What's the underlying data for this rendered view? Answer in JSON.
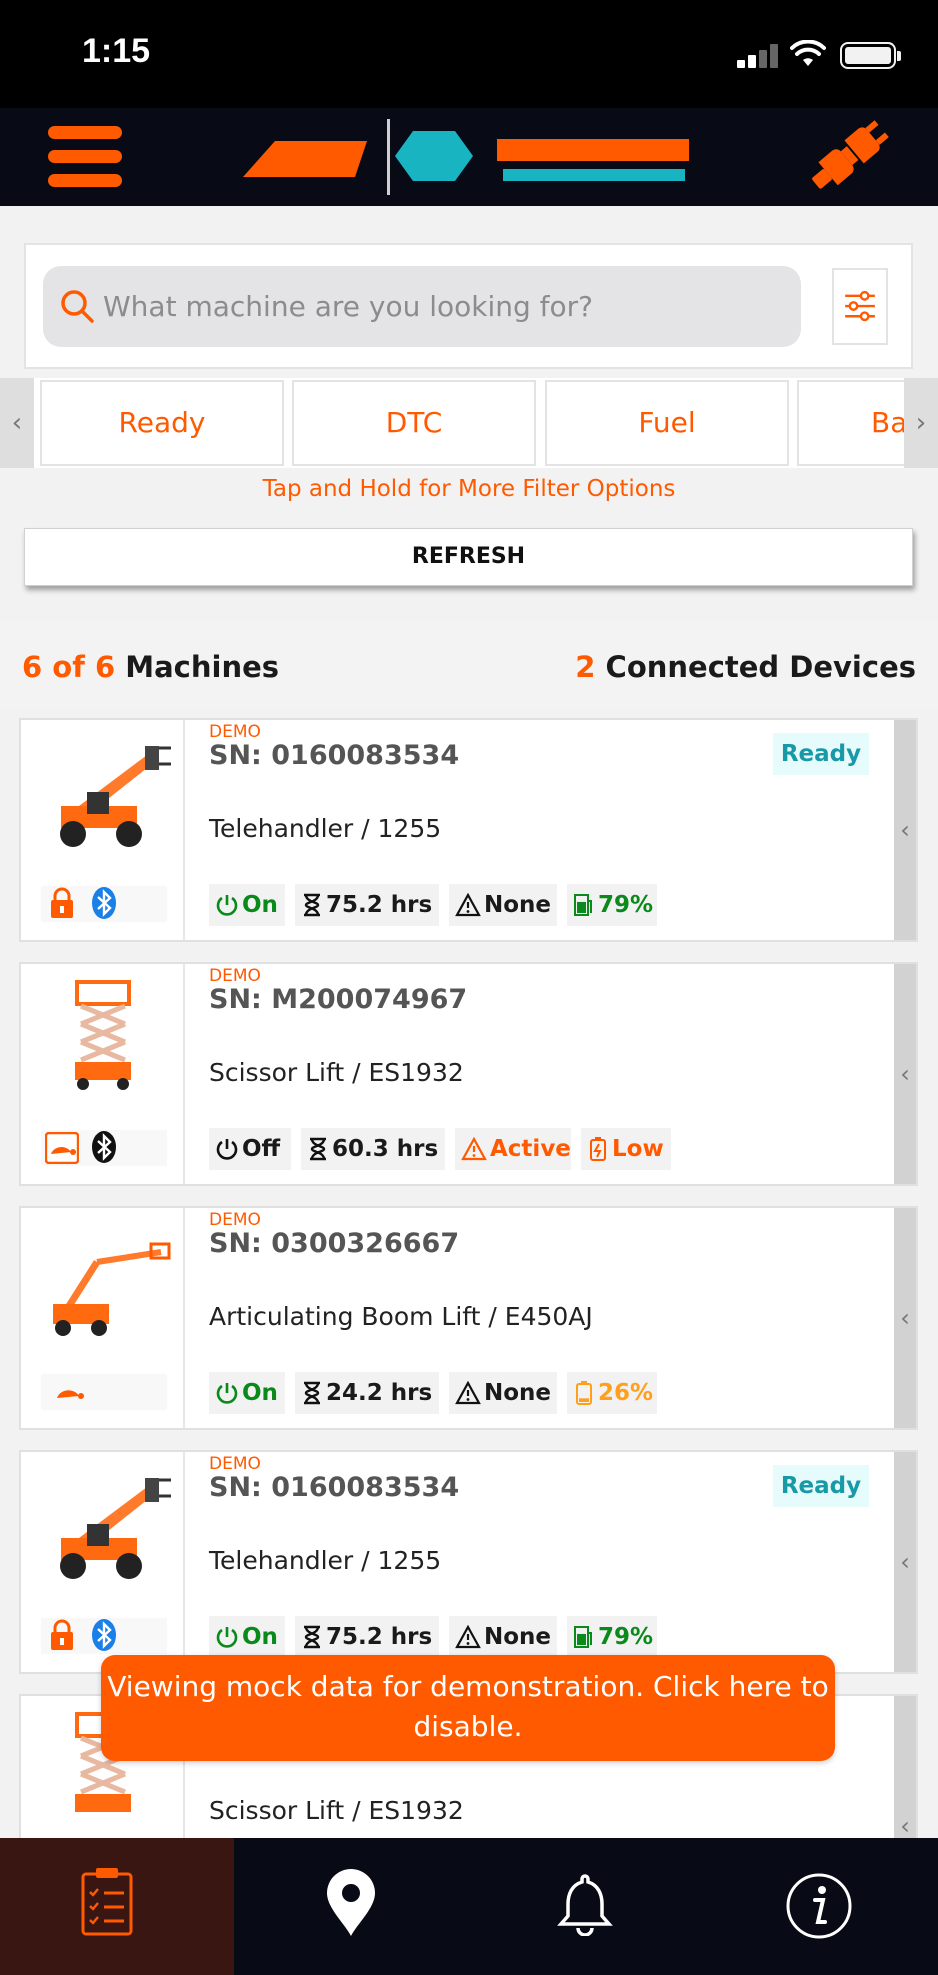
{
  "status_bar": {
    "time": "1:15"
  },
  "app_bar": {
    "menu_icon": "hamburger-menu-icon",
    "connect_icon": "plug-icon"
  },
  "search": {
    "placeholder": "What machine are you looking for?"
  },
  "filters": {
    "chips": [
      "Ready",
      "DTC",
      "Fuel",
      "Ba"
    ],
    "hint": "Tap and Hold for More Filter Options",
    "refresh_label": "REFRESH"
  },
  "summary": {
    "shown": "6",
    "of_word": "of",
    "total": "6",
    "machines_label": "Machines",
    "connected_count": "2",
    "connected_label": "Connected Devices"
  },
  "machines": [
    {
      "demo": "DEMO",
      "sn": "SN: 0160083534",
      "model": "Telehandler / 1255",
      "badge": "Ready",
      "power": "On",
      "hours": "75.2 hrs",
      "dtc": "None",
      "fuel": "79%",
      "fuel_level": 0.79
    },
    {
      "demo": "DEMO",
      "sn": "SN: M200074967",
      "model": "Scissor Lift / ES1932",
      "badge": "",
      "power": "Off",
      "hours": "60.3 hrs",
      "dtc": "Active",
      "fuel": "Low"
    },
    {
      "demo": "DEMO",
      "sn": "SN: 0300326667",
      "model": "Articulating Boom Lift / E450AJ",
      "badge": "",
      "power": "On",
      "hours": "24.2 hrs",
      "dtc": "None",
      "fuel": "26%",
      "fuel_level": 0.26
    },
    {
      "demo": "DEMO",
      "sn": "SN: 0160083534",
      "model": "Telehandler / 1255",
      "badge": "Ready",
      "power": "On",
      "hours": "75.2 hrs",
      "dtc": "None",
      "fuel": "79%",
      "fuel_level": 0.79
    },
    {
      "model": "Scissor Lift / ES1932"
    }
  ],
  "toast": {
    "message": "Viewing mock data for demonstration. Click here to disable."
  },
  "tab_bar": {
    "tabs": [
      "machine-list-icon",
      "location-pin-icon",
      "bell-icon",
      "info-icon"
    ]
  },
  "colors": {
    "brand_orange": "#ff5a00",
    "brand_teal": "#19b4c2",
    "ready_text": "#1899a8",
    "on_green": "#0a8a1a",
    "navy": "#080a16"
  }
}
